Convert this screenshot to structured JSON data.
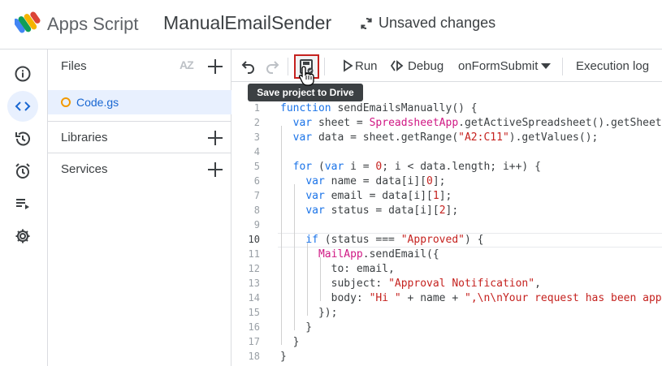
{
  "header": {
    "app_name": "Apps Script",
    "project_name": "ManualEmailSender",
    "status": "Unsaved changes"
  },
  "rail": {
    "items": [
      "overview",
      "editor",
      "versions",
      "triggers",
      "executions",
      "project-settings"
    ],
    "active": "editor"
  },
  "files_panel": {
    "title": "Files",
    "sort_label": "AZ",
    "files": [
      {
        "name": "Code.gs"
      }
    ],
    "sections": [
      {
        "label": "Libraries"
      },
      {
        "label": "Services"
      }
    ]
  },
  "toolbar": {
    "run_label": "Run",
    "debug_label": "Debug",
    "function_select": "onFormSubmit",
    "execution_log_label": "Execution log",
    "save_tooltip": "Save project to Drive"
  },
  "editor": {
    "current_line": 10,
    "line_numbers": [
      "1",
      "2",
      "3",
      "4",
      "5",
      "6",
      "7",
      "8",
      "9",
      "10",
      "11",
      "12",
      "13",
      "14",
      "15",
      "16",
      "17",
      "18"
    ],
    "lines": [
      "function sendEmailsManually() {",
      "  var sheet = SpreadsheetApp.getActiveSpreadsheet().getSheetB",
      "  var data = sheet.getRange(\"A2:C11\").getValues();",
      "",
      "  for (var i = 0; i < data.length; i++) {",
      "    var name = data[i][0];",
      "    var email = data[i][1];",
      "    var status = data[i][2];",
      "",
      "    if (status === \"Approved\") {",
      "      MailApp.sendEmail({",
      "        to: email,",
      "        subject: \"Approval Notification\",",
      "        body: \"Hi \" + name + \",\\n\\nYour request has been app",
      "      });",
      "    }",
      "  }",
      "}"
    ]
  },
  "colors": {
    "keyword": "#1a73e8",
    "string": "#c5221f",
    "class": "#d01884",
    "accent_bg": "#e8f0fe",
    "save_highlight": "#c5221f"
  }
}
